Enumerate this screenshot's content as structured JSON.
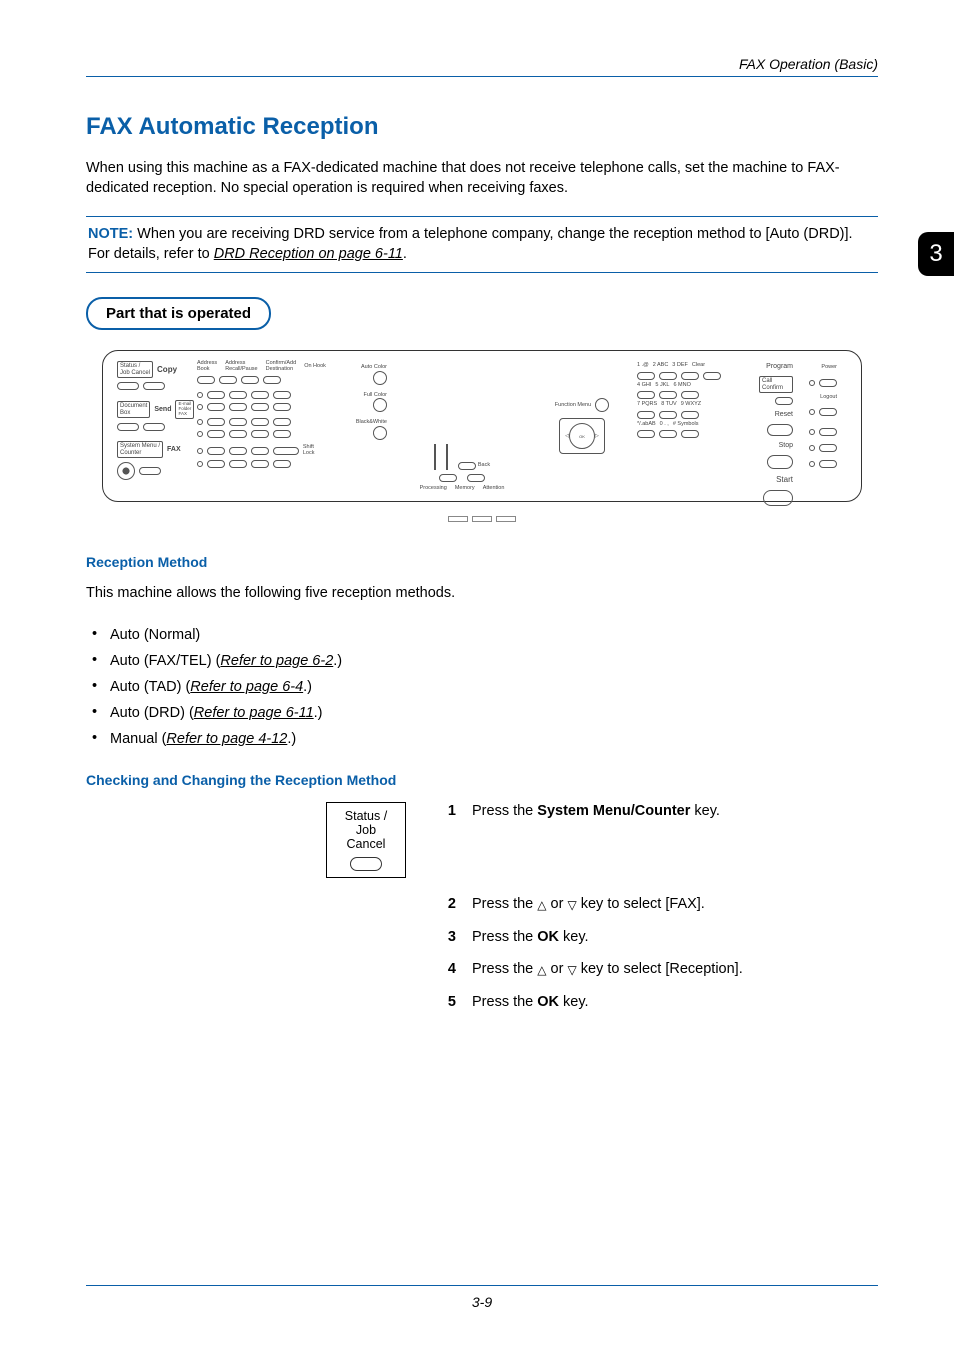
{
  "header": {
    "section": "FAX Operation (Basic)"
  },
  "chapter": "3",
  "title": "FAX Automatic Reception",
  "intro": "When using this machine as a FAX-dedicated machine that does not receive telephone calls, set the machine to FAX-dedicated reception. No special operation is required when receiving faxes.",
  "note": {
    "label": "NOTE:",
    "before_link": " When you are receiving DRD service from a telephone company, change the reception method to [Auto (DRD)]. For details, refer to ",
    "link": "DRD Reception on page 6-11",
    "after_link": "."
  },
  "part_operated": "Part that is operated",
  "panel": {
    "status_job_cancel": "Status /\nJob Cancel",
    "copy": "Copy",
    "document_box": "Document\nBox",
    "send": "Send",
    "system_menu": "System Menu /\nCounter",
    "fax": "FAX",
    "email": "E-mail",
    "folder": "Folder",
    "fax2": "FAX",
    "address_book": "Address\nBook",
    "address_recall": "Address\nRecall/Pause",
    "confirm_dest": "Confirm/Add\nDestination",
    "on_hook": "On Hook",
    "shift_lock": "Shift Lock",
    "auto_color": "Auto Color",
    "full_color": "Full Color",
    "bw": "Black&White",
    "back": "Back",
    "processing": "Processing",
    "memory": "Memory",
    "attention": "Attention",
    "function_menu": "Function Menu",
    "ok": "OK",
    "keys": {
      "1": "1 .@",
      "2": "2 ABC",
      "3": "3 DEF",
      "4": "4 GHI",
      "5": "5 JKL",
      "6": "6 MNO",
      "7": "7 PQRS",
      "8": "8 TUV",
      "9": "9 WXYZ",
      "star": "*/.abAB",
      "0": "0 . ,",
      "hash": "# Symbols"
    },
    "clear": "Clear",
    "program": "Program",
    "call_confirm": "Call Confirm",
    "reset": "Reset",
    "stop": "Stop",
    "start": "Start",
    "power": "Power",
    "logout": "Logout"
  },
  "reception_method": {
    "heading": "Reception Method",
    "intro": "This machine allows the following five reception methods.",
    "items": [
      {
        "text": "Auto (Normal)",
        "link": ""
      },
      {
        "text": "Auto (FAX/TEL) (",
        "link": "Refer to page 6-2",
        "after": ".)"
      },
      {
        "text": "Auto (TAD) (",
        "link": "Refer to page 6-4",
        "after": ".)"
      },
      {
        "text": "Auto (DRD) (",
        "link": "Refer to page 6-11",
        "after": ".)"
      },
      {
        "text": "Manual (",
        "link": "Refer to page 4-12",
        "after": ".)"
      }
    ]
  },
  "checking_heading": "Checking and Changing the Reception Method",
  "status_illustration": {
    "line1": "Status /",
    "line2": "Job Cancel"
  },
  "steps": [
    {
      "n": "1",
      "before": "Press the ",
      "bold": "System Menu/Counter",
      "after": " key."
    },
    {
      "n": "2",
      "plain": "Press the △ or ▽ key to select [FAX]."
    },
    {
      "n": "3",
      "before": "Press the ",
      "bold": "OK",
      "after": " key."
    },
    {
      "n": "4",
      "plain": "Press the △ or ▽ key to select [Reception]."
    },
    {
      "n": "5",
      "before": "Press the ",
      "bold": "OK",
      "after": " key."
    }
  ],
  "page_number": "3-9"
}
